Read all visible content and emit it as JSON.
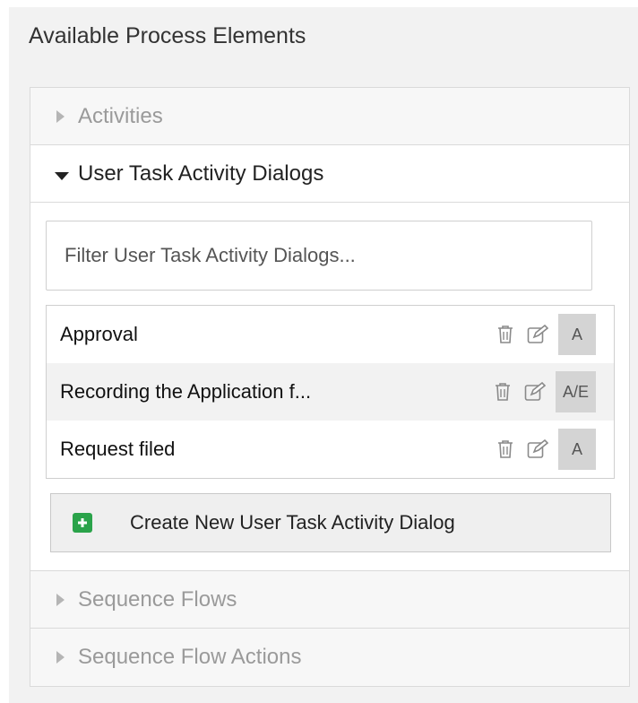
{
  "header": {
    "title": "Available Process Elements"
  },
  "accordion": {
    "activities": "Activities",
    "dialogs": {
      "title": "User Task Activity Dialogs",
      "filter_placeholder": "Filter User Task Activity Dialogs...",
      "items": [
        {
          "name": "Approval",
          "badge": "A"
        },
        {
          "name": "Recording the Application f...",
          "badge": "A/E"
        },
        {
          "name": "Request filed",
          "badge": "A"
        }
      ],
      "create_label": "Create New User Task Activity Dialog"
    },
    "sequence_flows": "Sequence Flows",
    "sequence_flow_actions": "Sequence Flow Actions"
  },
  "colors": {
    "accent_add": "#2aa34a",
    "badge_bg": "#d4d4d4"
  },
  "icons": [
    "caret-right-icon",
    "caret-down-icon",
    "trash-icon",
    "edit-icon",
    "plus-icon"
  ]
}
